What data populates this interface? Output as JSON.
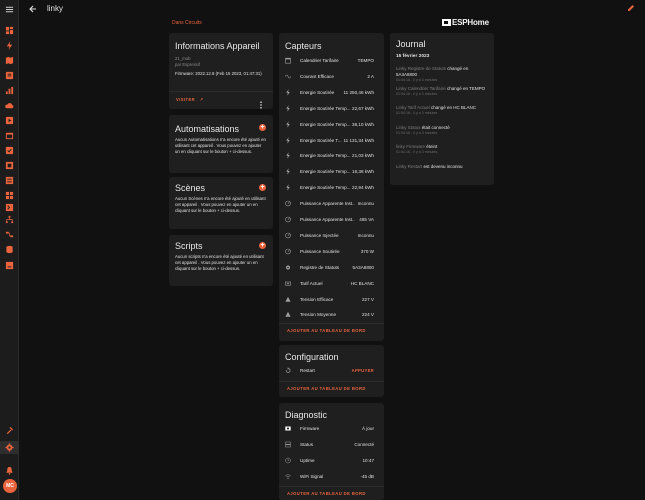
{
  "app": {
    "title": "linky",
    "breadcrumb": "Dans Circuits",
    "logo_text": "ESPHome",
    "avatar_initials": "MC",
    "accent_color": "#e9643c",
    "sidebar_icons": [
      "dashboard-icon",
      "energy-icon",
      "map-icon",
      "logbook-icon",
      "history-icon",
      "media-icon",
      "cloud-icon",
      "calendar-icon",
      "todo-icon",
      "hacs-icon",
      "zigbee-icon",
      "grid-icon",
      "network-icon",
      "node-red-icon",
      "database-icon",
      "terminal-icon",
      "developer-tools-icon",
      "settings-icon",
      "notifications-icon"
    ]
  },
  "device_info": {
    "title": "Informations Appareil",
    "model": "21_mob",
    "by": "par Espressif",
    "firmware": "Firmware: 2022.12.8 (Feb 15 2023, 01:47:31)",
    "visit_label": "VISITER"
  },
  "automations": {
    "title": "Automatisations",
    "text": "Aucun Automatisations n'a encore été ajouté en utilisant cet appareil . Vous pouvez en ajouter un en cliquant sur le bouton + ci-dessus."
  },
  "scenes": {
    "title": "Scènes",
    "text": "Aucun Scènes n'a encore été ajouté en utilisant cet appareil . Vous pouvez en ajouter un en cliquant sur le bouton + ci-dessus."
  },
  "scripts": {
    "title": "Scripts",
    "text": "Aucun scripts n'a encore été ajouté en utilisant cet appareil . Vous pouvez en ajouter un en cliquant sur le bouton + ci-dessus."
  },
  "sensors": {
    "title": "Capteurs",
    "add_label": "AJOUTER AU TABLEAU DE BORD",
    "rows": [
      {
        "icon": "calendar-icon",
        "name": "Calendrier Tarifaire",
        "value": "TEMPO"
      },
      {
        "icon": "sine-wave-icon",
        "name": "Courant Efficace",
        "value": "2 A"
      },
      {
        "icon": "flash-icon",
        "name": "Energie Soutirée",
        "value": "11 250,46 kWh"
      },
      {
        "icon": "flash-icon",
        "name": "Energie Soutirée Temp...",
        "value": "22,67 kWh"
      },
      {
        "icon": "flash-icon",
        "name": "Energie Soutirée Temp...",
        "value": "36,10 kWh"
      },
      {
        "icon": "flash-icon",
        "name": "Energie Soutirée T...",
        "value": "11 131,34 kWh"
      },
      {
        "icon": "flash-icon",
        "name": "Energie Soutirée Temp...",
        "value": "21,03 kWh"
      },
      {
        "icon": "flash-icon",
        "name": "Energie Soutirée Temp...",
        "value": "16,38 kWh"
      },
      {
        "icon": "flash-icon",
        "name": "Energie Soutirée Temp...",
        "value": "22,94 kWh"
      },
      {
        "icon": "gauge-icon",
        "name": "Puissance Apparente Inst...",
        "value": "Inconnu"
      },
      {
        "icon": "gauge-icon",
        "name": "Puissance Apparente Inst...",
        "value": "485 VA"
      },
      {
        "icon": "gauge-icon",
        "name": "Puissance Injectée",
        "value": "Inconnu"
      },
      {
        "icon": "gauge-icon",
        "name": "Puissance Soutirée",
        "value": "370 W"
      },
      {
        "icon": "gear-icon",
        "name": "Registre de Statuts",
        "value": "5A3A8800"
      },
      {
        "icon": "cash-icon",
        "name": "Tarif Actuel",
        "value": "HC BLANC"
      },
      {
        "icon": "voltage-icon",
        "name": "Tension Efficace",
        "value": "227 V"
      },
      {
        "icon": "voltage-icon",
        "name": "Tension Moyenne",
        "value": "224 V"
      }
    ]
  },
  "configuration": {
    "title": "Configuration",
    "row_name": "Restart",
    "row_action": "APPUYER",
    "add_label": "AJOUTER AU TABLEAU DE BORD"
  },
  "diagnostic": {
    "title": "Diagnostic",
    "add_label": "AJOUTER AU TABLEAU DE BORD",
    "rows": [
      {
        "icon": "chip-icon",
        "name": "Firmware",
        "value": "À jour"
      },
      {
        "icon": "server-icon",
        "name": "Status",
        "value": "Connecté"
      },
      {
        "icon": "clock-icon",
        "name": "Uptime",
        "value": "10:47"
      },
      {
        "icon": "wifi-icon",
        "name": "WiFi Signal",
        "value": "-45 dB"
      }
    ]
  },
  "journal": {
    "title": "Journal",
    "date": "15 février 2023",
    "entries": [
      {
        "name": "Linky Registre de Statuts",
        "text": "changé en 5A3A8800",
        "time": "01:54:16 - Il y a 3 minutes"
      },
      {
        "name": "Linky Calendrier Tarifaire",
        "text": "changé en TEMPO",
        "time": "01:54:16 - Il y a 3 minutes"
      },
      {
        "name": "Linky Tarif Actuel",
        "text": "changé en HC BLANC",
        "time": "01:54:16 - Il y a 3 minutes"
      },
      {
        "name": "Linky Status",
        "text": "était connecté",
        "time": "01:54:16 - Il y a 3 minutes"
      },
      {
        "name": "linky Firmware",
        "text": "éteint",
        "time": "01:54:16 - Il y a 3 minutes"
      },
      {
        "name": "Linky Restart",
        "text": "est devenu inconnu",
        "time": ""
      }
    ]
  }
}
